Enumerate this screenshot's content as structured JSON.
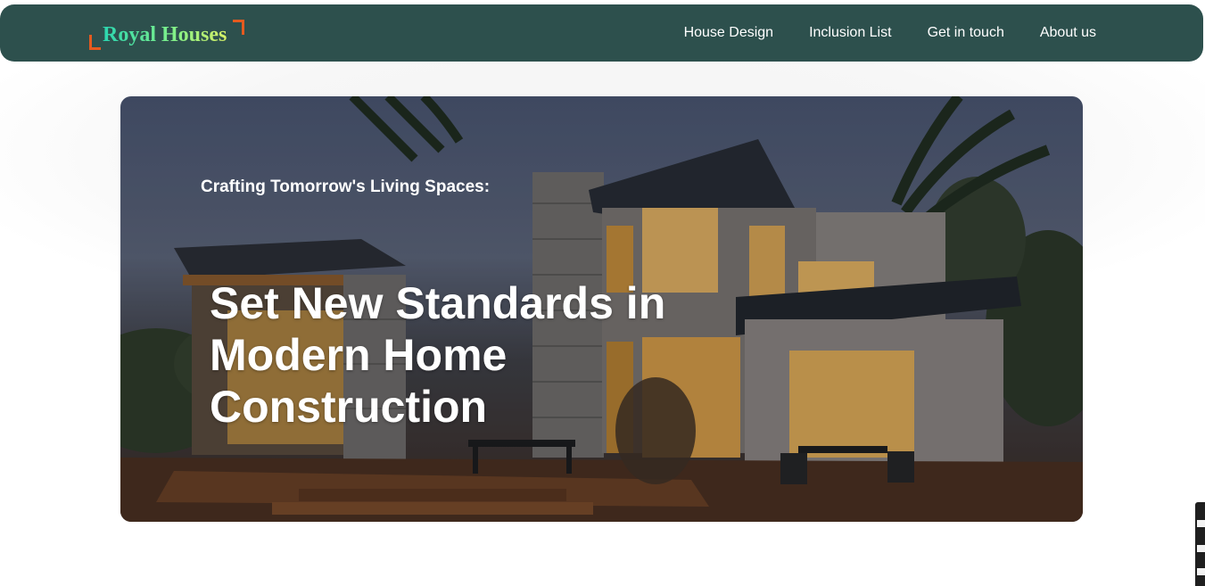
{
  "brand": {
    "logo_text": "Royal Houses"
  },
  "nav": {
    "links": [
      {
        "label": "House Design"
      },
      {
        "label": "Inclusion List"
      },
      {
        "label": "Get in touch"
      },
      {
        "label": "About us"
      }
    ]
  },
  "hero": {
    "tagline": "Crafting Tomorrow's Living Spaces:",
    "headline": "Set New Standards in Modern Home Construction",
    "image": "modern-house-evening-photo"
  },
  "colors": {
    "navbar_bg": "#2d504d",
    "logo_gradient": [
      "#2bd6b0",
      "#d6f066"
    ],
    "logo_accent": "#e55a1f",
    "nav_text": "#ffffff"
  }
}
